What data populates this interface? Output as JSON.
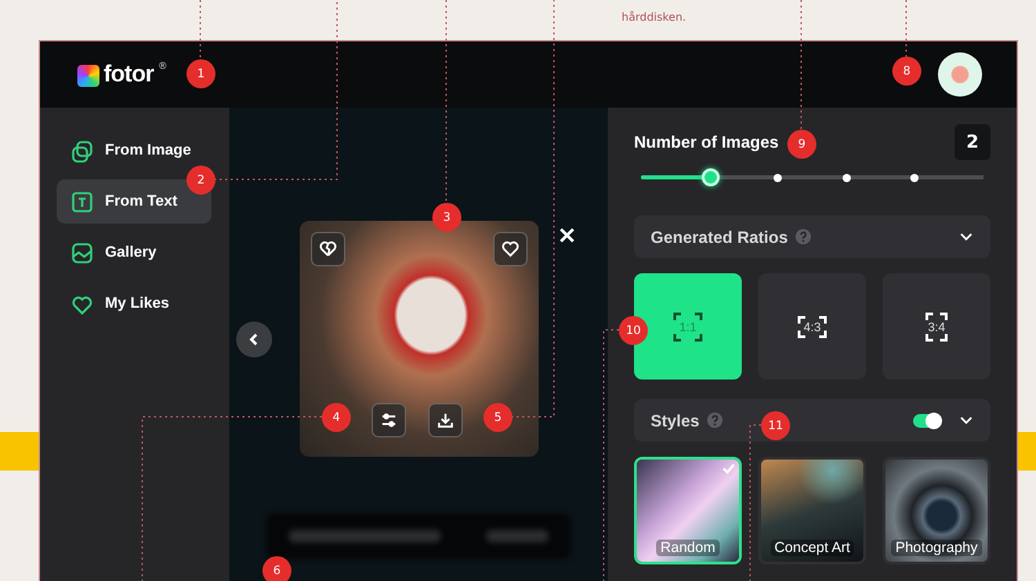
{
  "caption_fragment": "hårddisken.",
  "app": {
    "header": {
      "logo_text": "fotor",
      "logo_mark": "®"
    },
    "sidebar": {
      "items": [
        {
          "label": "From Image",
          "selected": false
        },
        {
          "label": "From Text",
          "selected": true
        },
        {
          "label": "Gallery",
          "selected": false
        },
        {
          "label": "My Likes",
          "selected": false
        }
      ]
    },
    "settings": {
      "number_of_images": {
        "label": "Number of Images",
        "value": "2",
        "level": 0.2
      },
      "ratios": {
        "title": "Generated Ratios",
        "options": [
          {
            "label": "1:1",
            "selected": true
          },
          {
            "label": "4:3",
            "selected": false
          },
          {
            "label": "3:4",
            "selected": false
          }
        ]
      },
      "styles": {
        "title": "Styles",
        "on": true,
        "options": [
          {
            "label": "Random",
            "selected": true
          },
          {
            "label": "Concept Art",
            "selected": false
          },
          {
            "label": "Photography",
            "selected": false
          }
        ]
      }
    }
  },
  "markers": [
    "1",
    "2",
    "3",
    "4",
    "5",
    "6",
    "8",
    "9",
    "10",
    "11"
  ]
}
